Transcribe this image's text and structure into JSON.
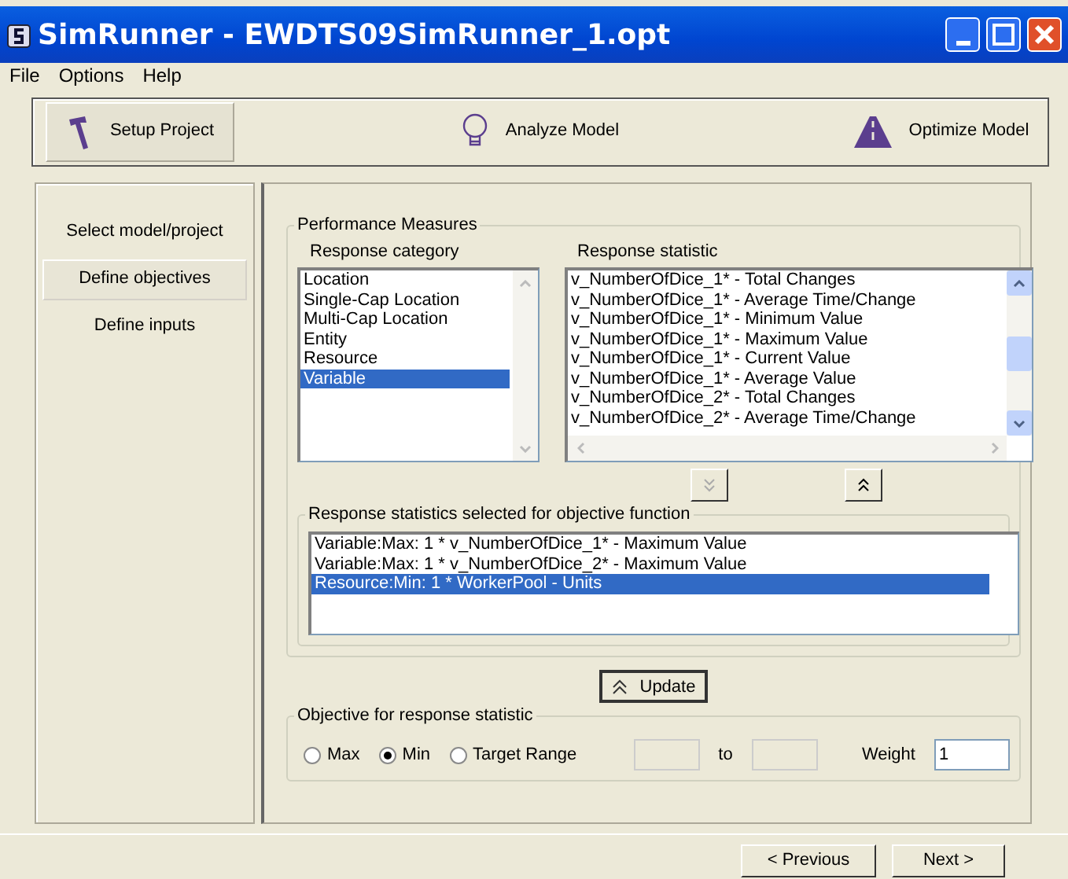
{
  "window": {
    "title": "SimRunner - EWDTS09SimRunner_1.opt"
  },
  "menu": [
    "File",
    "Options",
    "Help"
  ],
  "toolbar": [
    {
      "label": "Setup Project",
      "selected": true
    },
    {
      "label": "Analyze Model",
      "selected": false
    },
    {
      "label": "Optimize Model",
      "selected": false
    }
  ],
  "sidebar": {
    "items": [
      {
        "label": "Select model/project",
        "selected": false
      },
      {
        "label": "Define objectives",
        "selected": true
      },
      {
        "label": "Define inputs",
        "selected": false
      }
    ]
  },
  "performance_measures": {
    "title": "Performance Measures",
    "category": {
      "label": "Response category",
      "items": [
        {
          "text": "Location",
          "selected": false
        },
        {
          "text": "Single-Cap Location",
          "selected": false
        },
        {
          "text": "Multi-Cap Location",
          "selected": false
        },
        {
          "text": "Entity",
          "selected": false
        },
        {
          "text": "Resource",
          "selected": false
        },
        {
          "text": "Variable",
          "selected": true
        }
      ]
    },
    "statistic": {
      "label": "Response statistic",
      "items": [
        {
          "text": "v_NumberOfDice_1* - Total Changes",
          "selected": false
        },
        {
          "text": "v_NumberOfDice_1* - Average Time/Change",
          "selected": false
        },
        {
          "text": "v_NumberOfDice_1* - Minimum Value",
          "selected": false
        },
        {
          "text": "v_NumberOfDice_1* - Maximum Value",
          "selected": false
        },
        {
          "text": "v_NumberOfDice_1* - Current Value",
          "selected": false
        },
        {
          "text": "v_NumberOfDice_1* - Average Value",
          "selected": false
        },
        {
          "text": "v_NumberOfDice_2* - Total Changes",
          "selected": false
        },
        {
          "text": "v_NumberOfDice_2* - Average Time/Change",
          "selected": false
        }
      ]
    },
    "add_button": {
      "disabled": true
    },
    "remove_button": {
      "disabled": false
    }
  },
  "selected_statistics": {
    "title": "Response statistics selected for objective function",
    "items": [
      {
        "text": "Variable:Max: 1 * v_NumberOfDice_1* - Maximum Value",
        "selected": false
      },
      {
        "text": "Variable:Max: 1 * v_NumberOfDice_2* - Maximum Value",
        "selected": false
      },
      {
        "text": "Resource:Min: 1 * WorkerPool - Units",
        "selected": true
      }
    ]
  },
  "update_button": "Update",
  "objective": {
    "title": "Objective for response statistic",
    "options": [
      {
        "label": "Max",
        "selected": false
      },
      {
        "label": "Min",
        "selected": true
      },
      {
        "label": "Target Range",
        "selected": false
      }
    ],
    "to_label": "to",
    "weight_label": "Weight",
    "weight_value": "1"
  },
  "navigation": [
    "< Previous",
    "Next >"
  ]
}
